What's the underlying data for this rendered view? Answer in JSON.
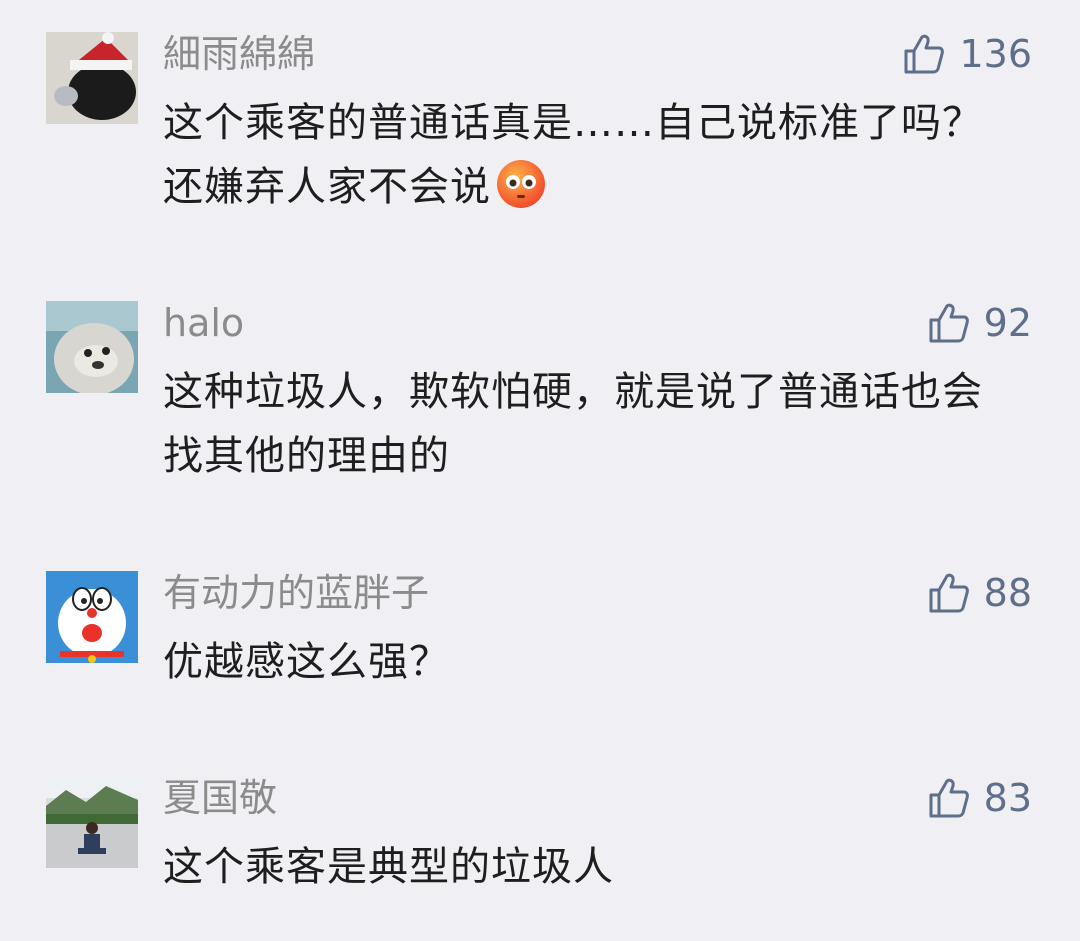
{
  "comments": [
    {
      "username": "細雨綿綿",
      "likes": "136",
      "text": "这个乘客的普通话真是……自己说标准了吗？还嫌弃人家不会说",
      "emoji": "flushed-face-emoji"
    },
    {
      "username": "halo",
      "likes": "92",
      "text": "这种垃圾人，欺软怕硬，就是说了普通话也会找其他的理由的"
    },
    {
      "username": "有动力的蓝胖子",
      "likes": "88",
      "text": "优越感这么强？"
    },
    {
      "username": "夏国敬",
      "likes": "83",
      "text": "这个乘客是典型的垃圾人"
    }
  ],
  "icons": {
    "like": "thumbs-up-icon"
  },
  "colors": {
    "background": "#efeff4",
    "username": "#8b8b8b",
    "like": "#5f6f8a",
    "text": "#1e1e1e"
  }
}
